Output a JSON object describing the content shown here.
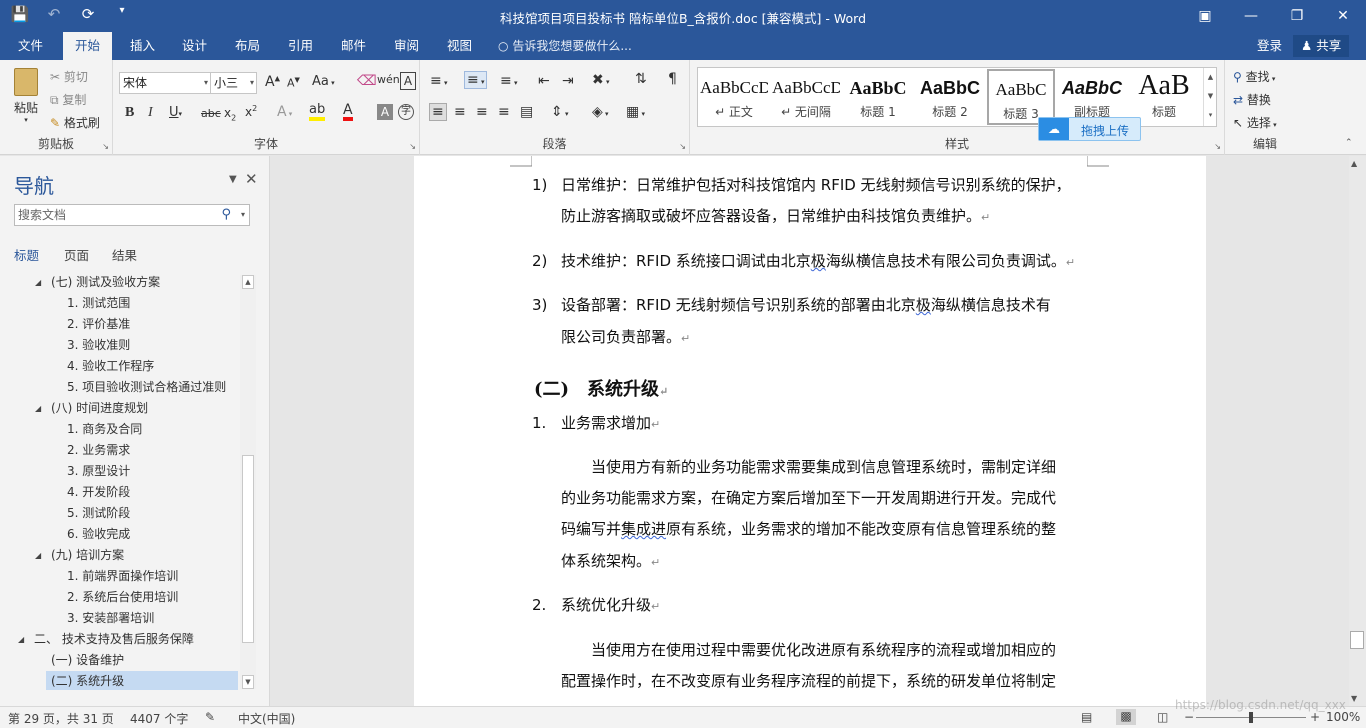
{
  "titlebar": {
    "title": "科技馆项目项目投标书 陪标单位B_含报价.doc [兼容模式] - Word",
    "qat": [
      "save-icon",
      "undo-icon",
      "redo-icon",
      "customize-icon"
    ],
    "window_buttons": [
      "restore-ribbon-icon",
      "minimize-icon",
      "maximize-icon",
      "close-icon"
    ]
  },
  "tabs": [
    {
      "label": "文件"
    },
    {
      "label": "开始"
    },
    {
      "label": "插入"
    },
    {
      "label": "设计"
    },
    {
      "label": "布局"
    },
    {
      "label": "引用"
    },
    {
      "label": "邮件"
    },
    {
      "label": "审阅"
    },
    {
      "label": "视图"
    }
  ],
  "active_tab": "开始",
  "tellme": "告诉我您想要做什么...",
  "signin": "登录",
  "share": "共享",
  "clipboard": {
    "paste": "粘贴",
    "cut": "剪切",
    "copy": "复制",
    "format_painter": "格式刷",
    "label": "剪贴板"
  },
  "font": {
    "name": "宋体",
    "size": "小三",
    "label": "字体",
    "change_case": "Aa"
  },
  "paragraph": {
    "label": "段落"
  },
  "styles": {
    "label": "样式",
    "items": [
      {
        "preview": "AaBbCcDd",
        "name": "↵ 正文"
      },
      {
        "preview": "AaBbCcDd",
        "name": "↵ 无间隔"
      },
      {
        "preview": "AaBbC",
        "name": "标题 1"
      },
      {
        "preview": "AaBbC",
        "name": "标题 2"
      },
      {
        "preview": "AaBbC",
        "name": "标题 3"
      },
      {
        "preview": "AaBbC",
        "name": "副标题"
      },
      {
        "preview": "AaB",
        "name": "标题"
      }
    ]
  },
  "editing": {
    "find": "查找",
    "replace": "替换",
    "select": "选择",
    "label": "编辑"
  },
  "upload": {
    "label": "拖拽上传"
  },
  "nav": {
    "title": "导航",
    "search_placeholder": "搜索文档",
    "tabs": [
      "标题",
      "页面",
      "结果"
    ],
    "items": [
      {
        "text": "(七) 测试及验收方案",
        "level": 2,
        "expanded": true
      },
      {
        "text": "1. 测试范围",
        "level": 3
      },
      {
        "text": "2. 评价基准",
        "level": 3
      },
      {
        "text": "3. 验收准则",
        "level": 3
      },
      {
        "text": "4. 验收工作程序",
        "level": 3
      },
      {
        "text": "5. 项目验收测试合格通过准则",
        "level": 3
      },
      {
        "text": "(八) 时间进度规划",
        "level": 2,
        "expanded": true
      },
      {
        "text": "1. 商务及合同",
        "level": 3
      },
      {
        "text": "2. 业务需求",
        "level": 3
      },
      {
        "text": "3. 原型设计",
        "level": 3
      },
      {
        "text": "4. 开发阶段",
        "level": 3
      },
      {
        "text": "5. 测试阶段",
        "level": 3
      },
      {
        "text": "6. 验收完成",
        "level": 3
      },
      {
        "text": "(九) 培训方案",
        "level": 2,
        "expanded": true
      },
      {
        "text": "1. 前端界面操作培训",
        "level": 3
      },
      {
        "text": "2. 系统后台使用培训",
        "level": 3
      },
      {
        "text": "3. 安装部署培训",
        "level": 3
      },
      {
        "text": "二、 技术支持及售后服务保障",
        "level": 1,
        "expanded": true
      },
      {
        "text": "(一) 设备维护",
        "level": 2
      },
      {
        "text": "(二) 系统升级",
        "level": 2,
        "selected": true
      }
    ]
  },
  "document": {
    "lines": [
      {
        "num": "1)",
        "text": "日常维护：日常维护包括对科技馆馆内 RFID 无线射频信号识别系统的保护，"
      },
      {
        "num": "",
        "text": "防止游客摘取或破坏应答器设备，日常维护由科技馆负责维护。"
      },
      {
        "num": "2)",
        "text_a": "技术维护：RFID 系统接口调试由北京",
        "sq": "极",
        "text_b": "海纵横信息技术有限公司负责调试。"
      },
      {
        "num": "3)",
        "text_a": "设备部署：RFID 无线射频信号识别系统的部署由北京",
        "sq": "极",
        "text_b": "海纵横信息技术有"
      },
      {
        "num": "",
        "text": "限公司负责部署。"
      },
      {
        "heading": "(二)　系统升级"
      },
      {
        "num": "1.",
        "text": "业务需求增加"
      },
      {
        "num": "",
        "text": "　　当使用方有新的业务功能需求需要集成到信息管理系统时，需制定详细"
      },
      {
        "num": "",
        "text": "的业务功能需求方案，在确定方案后增加至下一开发周期进行开发。完成代"
      },
      {
        "num": "",
        "text_a": "码编写并",
        "sq": "集成进",
        "text_b": "原有系统，业务需求的增加不能改变原有信息管理系统的整"
      },
      {
        "num": "",
        "text": "体系统架构。"
      },
      {
        "num": "2.",
        "text": "系统优化升级"
      },
      {
        "num": "",
        "text": "　　当使用方在使用过程中需要优化改进原有系统程序的流程或增加相应的"
      },
      {
        "num": "",
        "text": "配置操作时，在不改变原有业务程序流程的前提下，系统的研发单位将制定"
      }
    ],
    "para_mark": "↵"
  },
  "status": {
    "page": "第 29 页，共 31 页",
    "words": "4407 个字",
    "lang": "中文(中国)",
    "zoom": "100%",
    "zoom_fraction": 0.5
  },
  "watermark": "https://blog.csdn.net/qq_xxx"
}
